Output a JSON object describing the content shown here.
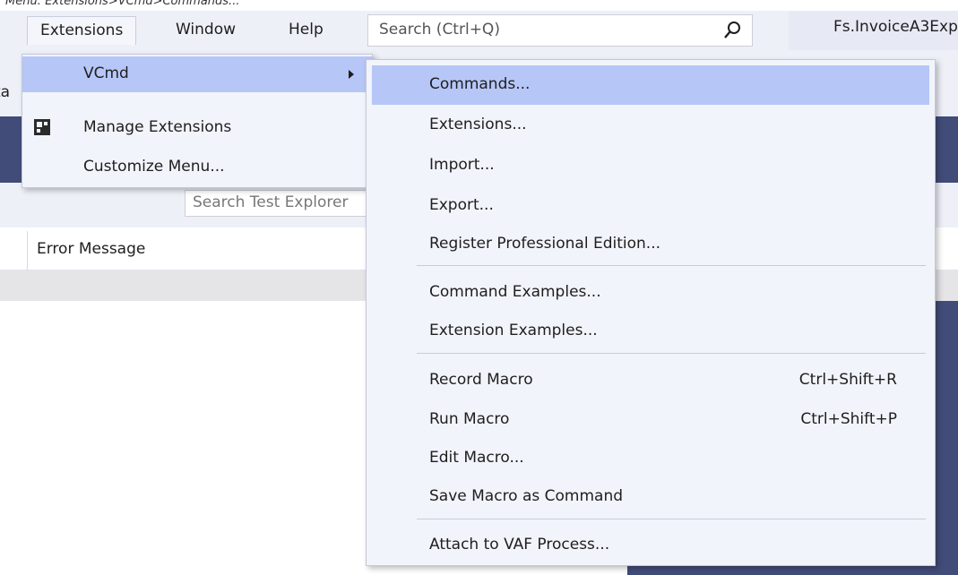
{
  "caption": "Menu: Extensions>VCmd>Commands...",
  "menubar": {
    "items": [
      {
        "label": "Extensions"
      },
      {
        "label": "Window"
      },
      {
        "label": "Help"
      }
    ]
  },
  "search": {
    "placeholder": "Search (Ctrl+Q)"
  },
  "solution_name": "Fs.InvoiceA3Exp",
  "cut_text": "ta",
  "test_explorer": {
    "search_placeholder": "Search Test Explorer",
    "column_header": "Error Message"
  },
  "extensions_menu": {
    "items": [
      {
        "label": "VCmd"
      },
      {
        "label": "Manage Extensions"
      },
      {
        "label": "Customize Menu..."
      }
    ]
  },
  "vcmd_menu": {
    "items": [
      {
        "label": "Commands...",
        "shortcut": ""
      },
      {
        "label": "Extensions...",
        "shortcut": ""
      },
      {
        "label": "Import...",
        "shortcut": ""
      },
      {
        "label": "Export...",
        "shortcut": ""
      },
      {
        "label": "Register Professional Edition...",
        "shortcut": ""
      },
      {
        "label": "Command Examples...",
        "shortcut": ""
      },
      {
        "label": "Extension Examples...",
        "shortcut": ""
      },
      {
        "label": "Record Macro",
        "shortcut": "Ctrl+Shift+R"
      },
      {
        "label": "Run Macro",
        "shortcut": "Ctrl+Shift+P"
      },
      {
        "label": "Edit Macro...",
        "shortcut": ""
      },
      {
        "label": "Save Macro as Command",
        "shortcut": ""
      },
      {
        "label": "Attach to VAF Process...",
        "shortcut": ""
      }
    ]
  },
  "colors": {
    "highlight": "#b6c6f7",
    "menu_bg": "#f2f4fb",
    "panel_dark": "#424c78"
  },
  "icons": [
    "search-icon",
    "manage-extensions-icon",
    "submenu-arrow-icon"
  ]
}
